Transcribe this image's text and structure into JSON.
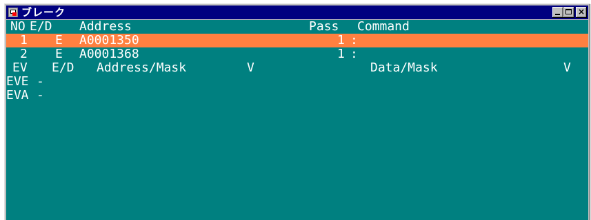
{
  "window": {
    "title": "ブレーク",
    "buttons": {
      "minimize_icon": "minimize-icon",
      "maximize_icon": "maximize-icon",
      "close_label": "×"
    }
  },
  "colors": {
    "background": "#008080",
    "selected_row": "#ff8040",
    "text": "#ffffff",
    "titlebar": "#000080"
  },
  "breakpoints": {
    "headers": {
      "no": "NO",
      "ed": "E/D",
      "address": "Address",
      "pass": "Pass",
      "command": "Command"
    },
    "rows": [
      {
        "no": "1",
        "ed": "E",
        "address": "A0001350",
        "pass": "1",
        "sep": ":",
        "selected": true
      },
      {
        "no": "2",
        "ed": "E",
        "address": "A0001368",
        "pass": "1",
        "sep": ":",
        "selected": false
      }
    ]
  },
  "events": {
    "headers": {
      "ev": "EV",
      "ed": "E/D",
      "address_mask": "Address/Mask",
      "v1": "V",
      "data_mask": "Data/Mask",
      "v2": "V"
    },
    "rows": [
      {
        "ev": "EVE",
        "value": "-"
      },
      {
        "ev": "EVA",
        "value": "-"
      }
    ]
  }
}
